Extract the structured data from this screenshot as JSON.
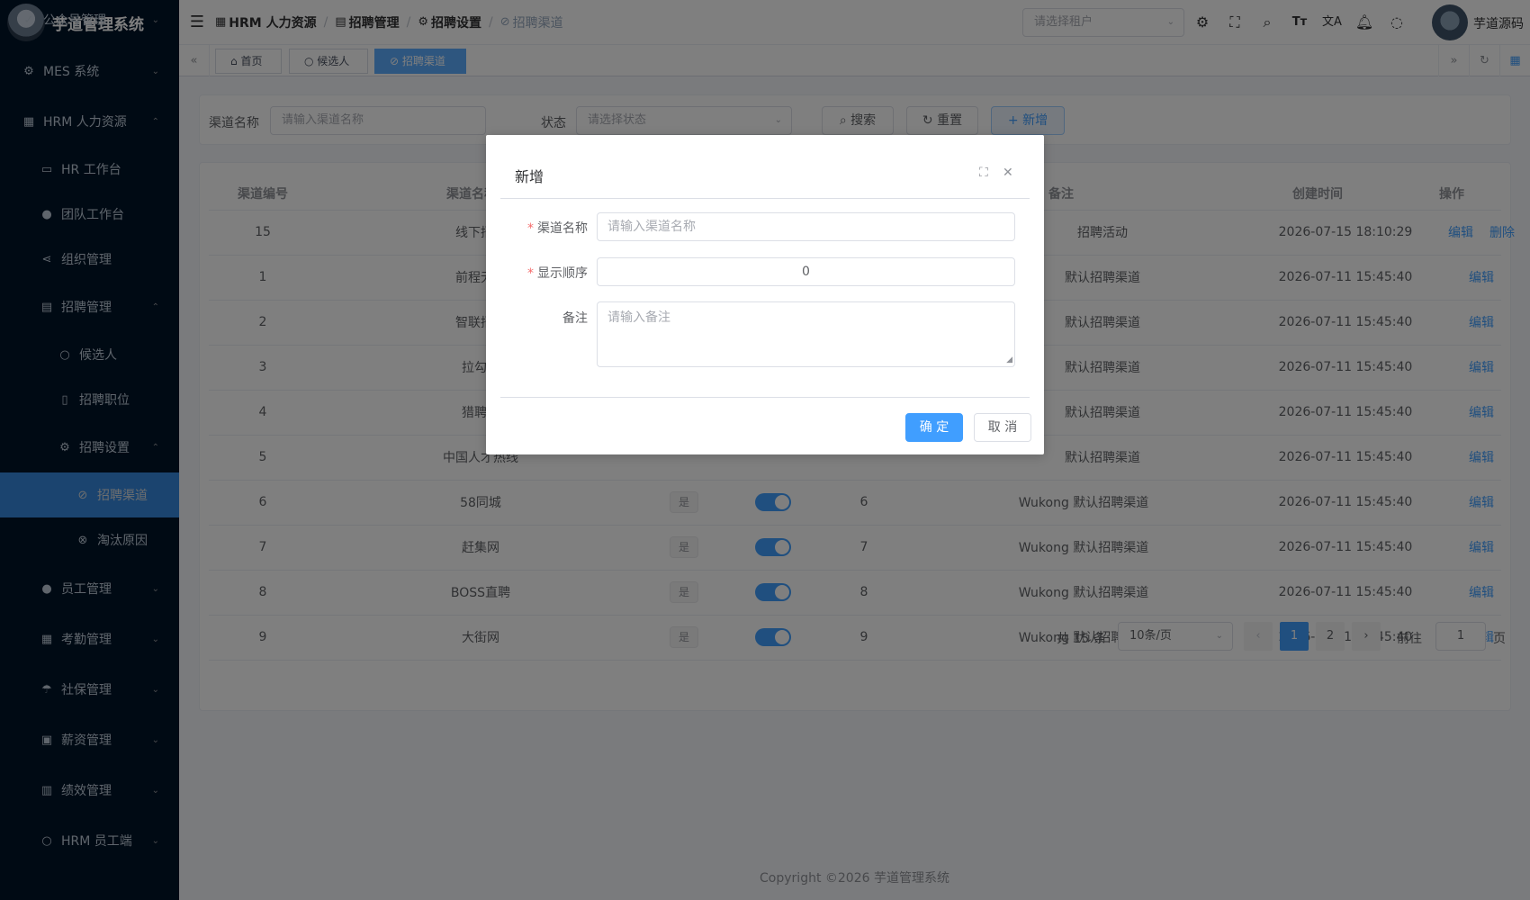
{
  "app": {
    "title": "芋道管理系统"
  },
  "sidebar": {
    "items": [
      {
        "label": "公众号管理",
        "icon": "check-circle-icon",
        "glyph": "✓"
      },
      {
        "label": "MES 系统",
        "icon": "gear-icon",
        "glyph": "⚙"
      },
      {
        "label": "HRM 人力资源",
        "icon": "building-icon",
        "glyph": "▦"
      },
      {
        "label": "HR 工作台",
        "icon": "monitor-icon",
        "glyph": "▭"
      },
      {
        "label": "团队工作台",
        "icon": "user-icon",
        "glyph": "●"
      },
      {
        "label": "组织管理",
        "icon": "share-icon",
        "glyph": "⋖"
      },
      {
        "label": "招聘管理",
        "icon": "briefcase-icon",
        "glyph": "▤"
      },
      {
        "label": "候选人",
        "icon": "user-outline-icon",
        "glyph": "○"
      },
      {
        "label": "招聘职位",
        "icon": "bookmark-icon",
        "glyph": "▯"
      },
      {
        "label": "招聘设置",
        "icon": "gear-icon",
        "glyph": "⚙"
      },
      {
        "label": "招聘渠道",
        "icon": "link-icon",
        "glyph": "⊘"
      },
      {
        "label": "淘汰原因",
        "icon": "circle-x-icon",
        "glyph": "⊗"
      },
      {
        "label": "员工管理",
        "icon": "user-icon",
        "glyph": "●"
      },
      {
        "label": "考勤管理",
        "icon": "calendar-icon",
        "glyph": "▦"
      },
      {
        "label": "社保管理",
        "icon": "umbrella-icon",
        "glyph": "☂"
      },
      {
        "label": "薪资管理",
        "icon": "wallet-icon",
        "glyph": "▣"
      },
      {
        "label": "绩效管理",
        "icon": "bar-chart-icon",
        "glyph": "▥"
      },
      {
        "label": "HRM 员工端",
        "icon": "user-outline-icon",
        "glyph": "○"
      }
    ]
  },
  "header": {
    "breadcrumb": [
      "HRM 人力资源",
      "招聘管理",
      "招聘设置",
      "招聘渠道"
    ],
    "tenant_placeholder": "请选择租户",
    "username": "芋道源码"
  },
  "tags": [
    "首页",
    "候选人",
    "招聘渠道"
  ],
  "search": {
    "name_label": "渠道名称",
    "name_placeholder": "请输入渠道名称",
    "status_label": "状态",
    "status_placeholder": "请选择状态",
    "search_btn": "搜索",
    "reset_btn": "重置",
    "add_btn": "新增"
  },
  "table": {
    "columns": [
      "渠道编号",
      "渠道名称",
      "备注",
      "创建时间",
      "操作"
    ],
    "rows": [
      {
        "id": "15",
        "name": "线下招聘",
        "remark": "招聘活动",
        "time": "2026-07-15 18:10:29",
        "actions": [
          "编辑",
          "删除"
        ]
      },
      {
        "id": "1",
        "name": "前程无忧",
        "remark": "默认招聘渠道",
        "time": "2026-07-11 15:45:40",
        "actions": [
          "编辑"
        ]
      },
      {
        "id": "2",
        "name": "智联招聘",
        "remark": "默认招聘渠道",
        "time": "2026-07-11 15:45:40",
        "actions": [
          "编辑"
        ]
      },
      {
        "id": "3",
        "name": "拉勾网",
        "remark": "默认招聘渠道",
        "time": "2026-07-11 15:45:40",
        "actions": [
          "编辑"
        ]
      },
      {
        "id": "4",
        "name": "猎聘网",
        "remark": "默认招聘渠道",
        "time": "2026-07-11 15:45:40",
        "actions": [
          "编辑"
        ]
      },
      {
        "id": "5",
        "name": "中国人才热线",
        "remark": "默认招聘渠道",
        "time": "2026-07-11 15:45:40",
        "actions": [
          "编辑"
        ]
      },
      {
        "id": "6",
        "name": "58同城",
        "default": "是",
        "sort": "6",
        "remark": "Wukong 默认招聘渠道",
        "time": "2026-07-11 15:45:40",
        "actions": [
          "编辑"
        ]
      },
      {
        "id": "7",
        "name": "赶集网",
        "default": "是",
        "sort": "7",
        "remark": "Wukong 默认招聘渠道",
        "time": "2026-07-11 15:45:40",
        "actions": [
          "编辑"
        ]
      },
      {
        "id": "8",
        "name": "BOSS直聘",
        "default": "是",
        "sort": "8",
        "remark": "Wukong 默认招聘渠道",
        "time": "2026-07-11 15:45:40",
        "actions": [
          "编辑"
        ]
      },
      {
        "id": "9",
        "name": "大街网",
        "default": "是",
        "sort": "9",
        "remark": "Wukong 默认招聘渠道",
        "time": "2026-07-11 15:45:40",
        "actions": [
          "编辑"
        ]
      }
    ]
  },
  "pagination": {
    "total": "共 15 条",
    "page_size": "10条/页",
    "pages": [
      "1",
      "2"
    ],
    "goto_label": "前往",
    "goto_value": "1",
    "page_unit": "页"
  },
  "footer": "Copyright ©2026 芋道管理系统",
  "dialog": {
    "title": "新增",
    "name_label": "渠道名称",
    "name_placeholder": "请输入渠道名称",
    "sort_label": "显示顺序",
    "sort_value": "0",
    "remark_label": "备注",
    "remark_placeholder": "请输入备注",
    "confirm": "确 定",
    "cancel": "取 消"
  },
  "colors": {
    "primary": "#409eff",
    "sidebar_bg": "#001529"
  }
}
